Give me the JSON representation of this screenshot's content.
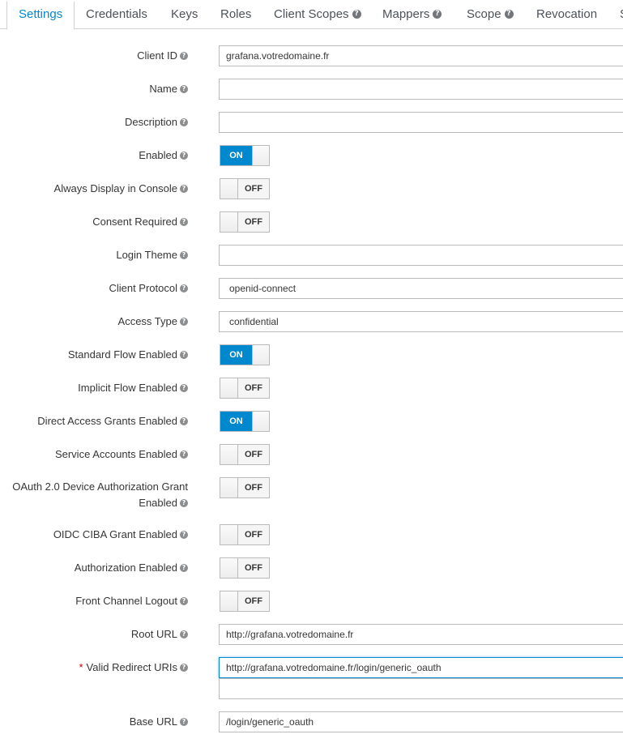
{
  "tabs": [
    {
      "label": "Settings",
      "help": false
    },
    {
      "label": "Credentials",
      "help": false
    },
    {
      "label": "Keys",
      "help": false
    },
    {
      "label": "Roles",
      "help": false
    },
    {
      "label": "Client Scopes",
      "help": true
    },
    {
      "label": "Mappers",
      "help": true
    },
    {
      "label": "Scope",
      "help": true
    },
    {
      "label": "Revocation",
      "help": false
    },
    {
      "label": "S",
      "help": false
    }
  ],
  "help_glyph": "?",
  "required_mark": "*",
  "toggle": {
    "on_label": "ON",
    "off_label": "OFF"
  },
  "fields": {
    "client_id": {
      "label": "Client ID",
      "value": "grafana.votredomaine.fr"
    },
    "name": {
      "label": "Name",
      "value": ""
    },
    "description": {
      "label": "Description",
      "value": ""
    },
    "enabled": {
      "label": "Enabled",
      "state": true
    },
    "always_display": {
      "label": "Always Display in Console",
      "state": false
    },
    "consent_required": {
      "label": "Consent Required",
      "state": false
    },
    "login_theme": {
      "label": "Login Theme",
      "value": ""
    },
    "client_protocol": {
      "label": "Client Protocol",
      "value": "openid-connect"
    },
    "access_type": {
      "label": "Access Type",
      "value": "confidential"
    },
    "standard_flow": {
      "label": "Standard Flow Enabled",
      "state": true
    },
    "implicit_flow": {
      "label": "Implicit Flow Enabled",
      "state": false
    },
    "direct_access": {
      "label": "Direct Access Grants Enabled",
      "state": true
    },
    "service_accounts": {
      "label": "Service Accounts Enabled",
      "state": false
    },
    "device_auth": {
      "label_line1": "OAuth 2.0 Device Authorization Grant",
      "label_line2": "Enabled",
      "state": false
    },
    "ciba": {
      "label": "OIDC CIBA Grant Enabled",
      "state": false
    },
    "authorization": {
      "label": "Authorization Enabled",
      "state": false
    },
    "front_channel": {
      "label": "Front Channel Logout",
      "state": false
    },
    "root_url": {
      "label": "Root URL",
      "value": "http://grafana.votredomaine.fr"
    },
    "redirect_uris": {
      "label": "Valid Redirect URIs",
      "value": "http://grafana.votredomaine.fr/login/generic_oauth",
      "extra_value": ""
    },
    "base_url": {
      "label": "Base URL",
      "value": "/login/generic_oauth"
    }
  }
}
